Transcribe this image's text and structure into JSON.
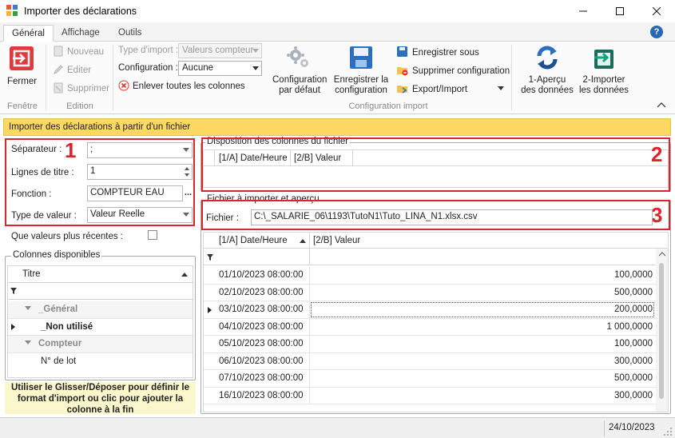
{
  "window": {
    "title": "Importer des déclarations"
  },
  "tabs": [
    "Général",
    "Affichage",
    "Outils"
  ],
  "ribbon": {
    "fenetre": {
      "close_label": "Fermer",
      "group": "Fenêtre"
    },
    "edition": {
      "new": "Nouveau",
      "edit": "Editer",
      "delete": "Supprimer",
      "group": "Edition"
    },
    "config": {
      "type_label": "Type d'import :",
      "type_value": "Valeurs compteur",
      "config_label": "Configuration :",
      "config_value": "Aucune",
      "remove_cols": "Enlever toutes les colonnes",
      "default_cfg_line1": "Configuration",
      "default_cfg_line2": "par défaut",
      "save_cfg_line1": "Enregistrer la",
      "save_cfg_line2": "configuration",
      "save_as": "Enregistrer sous",
      "delete_cfg": "Supprimer configuration",
      "export_import": "Export/Import",
      "group": "Configuration import"
    },
    "steps": {
      "preview_line1": "1-Aperçu",
      "preview_line2": "des données",
      "import_line1": "2-Importer",
      "import_line2": "les données"
    }
  },
  "banner": "Importer des déclarations à partir d'un fichier",
  "left": {
    "separator_label": "Séparateur :",
    "separator_value": ";",
    "title_lines_label": "Lignes de titre :",
    "title_lines_value": "1",
    "function_label": "Fonction :",
    "function_value": "COMPTEUR EAU",
    "function_btn": "...",
    "value_type_label": "Type de valeur :",
    "value_type_value": "Valeur Reelle",
    "recent_label": "Que valeurs plus récentes :",
    "available_cols_title": "Colonnes disponibles",
    "grid_header": "Titre",
    "groups": [
      {
        "name": "_Général",
        "items": [
          "_Non utilisé"
        ]
      },
      {
        "name": "Compteur",
        "items": [
          "N° de lot"
        ]
      }
    ],
    "hint": "Utiliser le Glisser/Déposer pour définir le format d'import ou clic pour ajouter la colonne à la fin"
  },
  "right": {
    "layout_title": "Disposition des colonnes du fichier",
    "layout_cols": [
      "[1/A] Date/Heure",
      "[2/B] Valeur"
    ],
    "file_title": "Fichier à importer et aperçu",
    "file_label": "Fichier :",
    "file_path": "C:\\_SALARIE_06\\1193\\TutoN1\\Tuto_LINA_N1.xlsx.csv",
    "preview_cols": [
      "[1/A] Date/Heure",
      "[2/B] Valeur"
    ],
    "rows": [
      {
        "date": "01/10/2023 08:00:00",
        "value": "100,0000"
      },
      {
        "date": "02/10/2023 08:00:00",
        "value": "500,0000"
      },
      {
        "date": "03/10/2023 08:00:00",
        "value": "200,0000"
      },
      {
        "date": "04/10/2023 08:00:00",
        "value": "1 000,0000"
      },
      {
        "date": "05/10/2023 08:00:00",
        "value": "100,0000"
      },
      {
        "date": "06/10/2023 08:00:00",
        "value": "300,0000"
      },
      {
        "date": "07/10/2023 08:00:00",
        "value": "500,0000"
      },
      {
        "date": "16/10/2023 08:00:00",
        "value": "300,0000"
      }
    ]
  },
  "annotations": [
    "1",
    "2",
    "3"
  ],
  "status": {
    "date": "24/10/2023"
  },
  "colors": {
    "banner": "#fdd862",
    "annotation": "#d9262c",
    "accent": "#2a67b1"
  }
}
